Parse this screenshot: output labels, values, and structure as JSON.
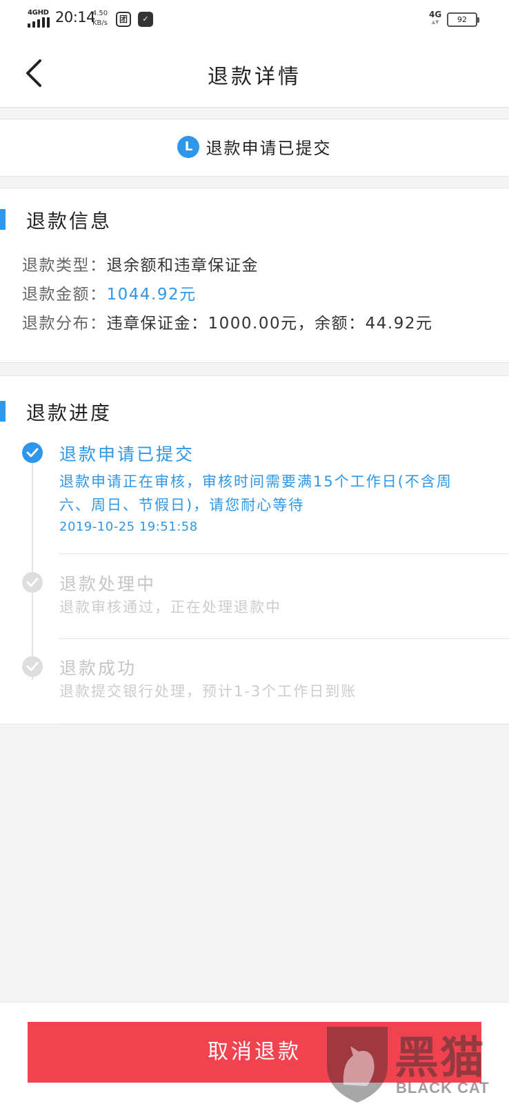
{
  "status_bar": {
    "network": "4GHD",
    "time": "20:14",
    "speed_value": "4.50",
    "speed_unit": "KB/s",
    "app_icon_1": "团",
    "app_icon_2": "✓",
    "network_right": "4G",
    "battery": "92"
  },
  "header": {
    "title": "退款详情",
    "back_icon": "chevron-left-icon"
  },
  "status": {
    "icon_letter": "L",
    "text": "退款申请已提交"
  },
  "refund_info": {
    "title": "退款信息",
    "rows": [
      {
        "label": "退款类型：",
        "value": "退余额和违章保证金"
      },
      {
        "label": "退款金额：",
        "value": "1044.92元"
      },
      {
        "label": "退款分布：",
        "value": "违章保证金：1000.00元，余额：44.92元"
      }
    ]
  },
  "progress": {
    "title": "退款进度",
    "steps": [
      {
        "title": "退款申请已提交",
        "desc_line1": "退款申请正在审核，审核时间需要满15个工作日(不含周",
        "desc_line2": "六、周日、节假日)，请您耐心等待",
        "time": "2019-10-25  19:51:58",
        "state": "active"
      },
      {
        "title": "退款处理中",
        "desc_line1": "退款审核通过，正在处理退款中",
        "state": "pending"
      },
      {
        "title": "退款成功",
        "desc_line1": "退款提交银行处理，预计1-3个工作日到账",
        "state": "pending"
      }
    ]
  },
  "footer": {
    "cancel_label": "取消退款"
  },
  "watermark": {
    "cn": "黑猫",
    "en": "BLACK CAT"
  },
  "colors": {
    "accent": "#2e97e9",
    "button": "#f1434f",
    "background": "#f4f4f5"
  }
}
